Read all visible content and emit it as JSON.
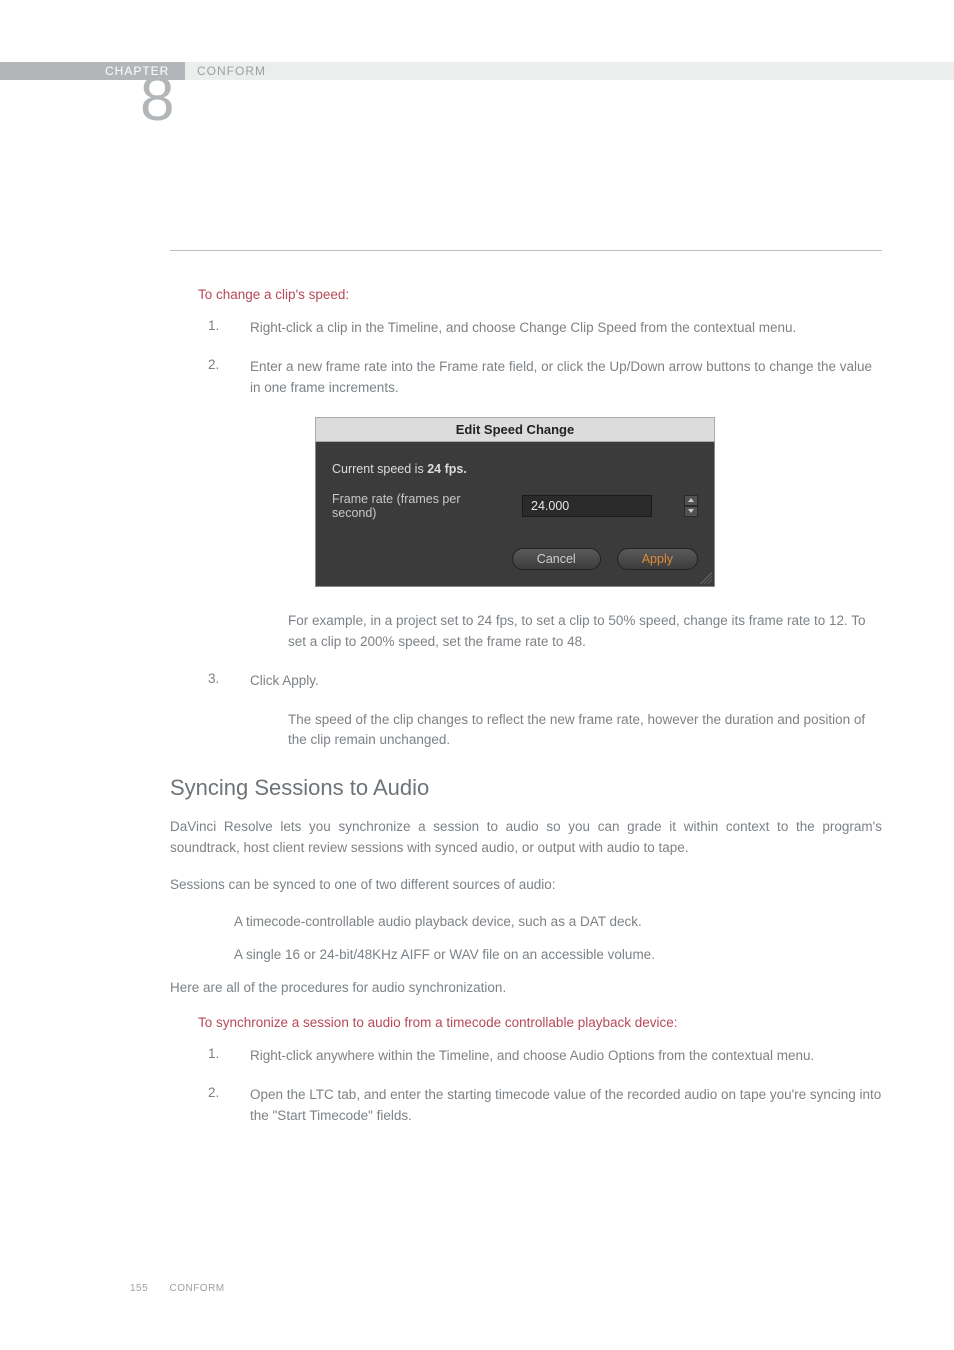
{
  "header": {
    "chapter_label": "CHAPTER",
    "section_label": "CONFORM",
    "chapter_number": "8"
  },
  "speed": {
    "title": "To change a clip's speed:",
    "steps": [
      {
        "n": "1.",
        "t": "Right-click a clip in the Timeline, and choose Change Clip Speed from the contextual menu."
      },
      {
        "n": "2.",
        "t": "Enter a new frame rate into the Frame rate field, or click the Up/Down arrow buttons to change the value in one frame increments."
      }
    ],
    "after2_a": "For example, in a project set to 24 fps, to set a clip to 50% speed, change its frame rate to 12. To set a clip to 200% speed, set the frame rate to 48.",
    "step3": {
      "n": "3.",
      "t": "Click Apply."
    },
    "after3": "The speed of the clip changes to reflect the new frame rate, however the duration and position of the clip remain unchanged."
  },
  "dialog": {
    "title": "Edit Speed Change",
    "current_prefix": "Current speed is ",
    "current_bold": "24 fps.",
    "rate_label": "Frame rate (frames per second)",
    "rate_value": "24.000",
    "cancel": "Cancel",
    "apply": "Apply"
  },
  "sync": {
    "heading": "Syncing Sessions to Audio",
    "p1": "DaVinci Resolve lets you synchronize a session to audio so you can grade it within context to the program's soundtrack, host client review sessions with synced audio, or output with audio to tape.",
    "p2": "Sessions can be synced to one of two different sources of audio:",
    "b1": "A timecode-controllable audio playback device, such as a DAT deck.",
    "b2": "A single 16 or 24-bit/48KHz AIFF or WAV file on an accessible volume.",
    "p3": "Here are all of the procedures for audio synchronization.",
    "sub": "To synchronize a session to audio from a timecode controllable playback device:",
    "steps": [
      {
        "n": "1.",
        "t": "Right-click anywhere within the Timeline, and choose Audio Options from the contextual menu."
      },
      {
        "n": "2.",
        "t": "Open the LTC tab, and enter the starting timecode value of the recorded audio on tape you're syncing into the \"Start Timecode\" fields."
      }
    ]
  },
  "footer": {
    "page": "155",
    "label": "CONFORM"
  }
}
